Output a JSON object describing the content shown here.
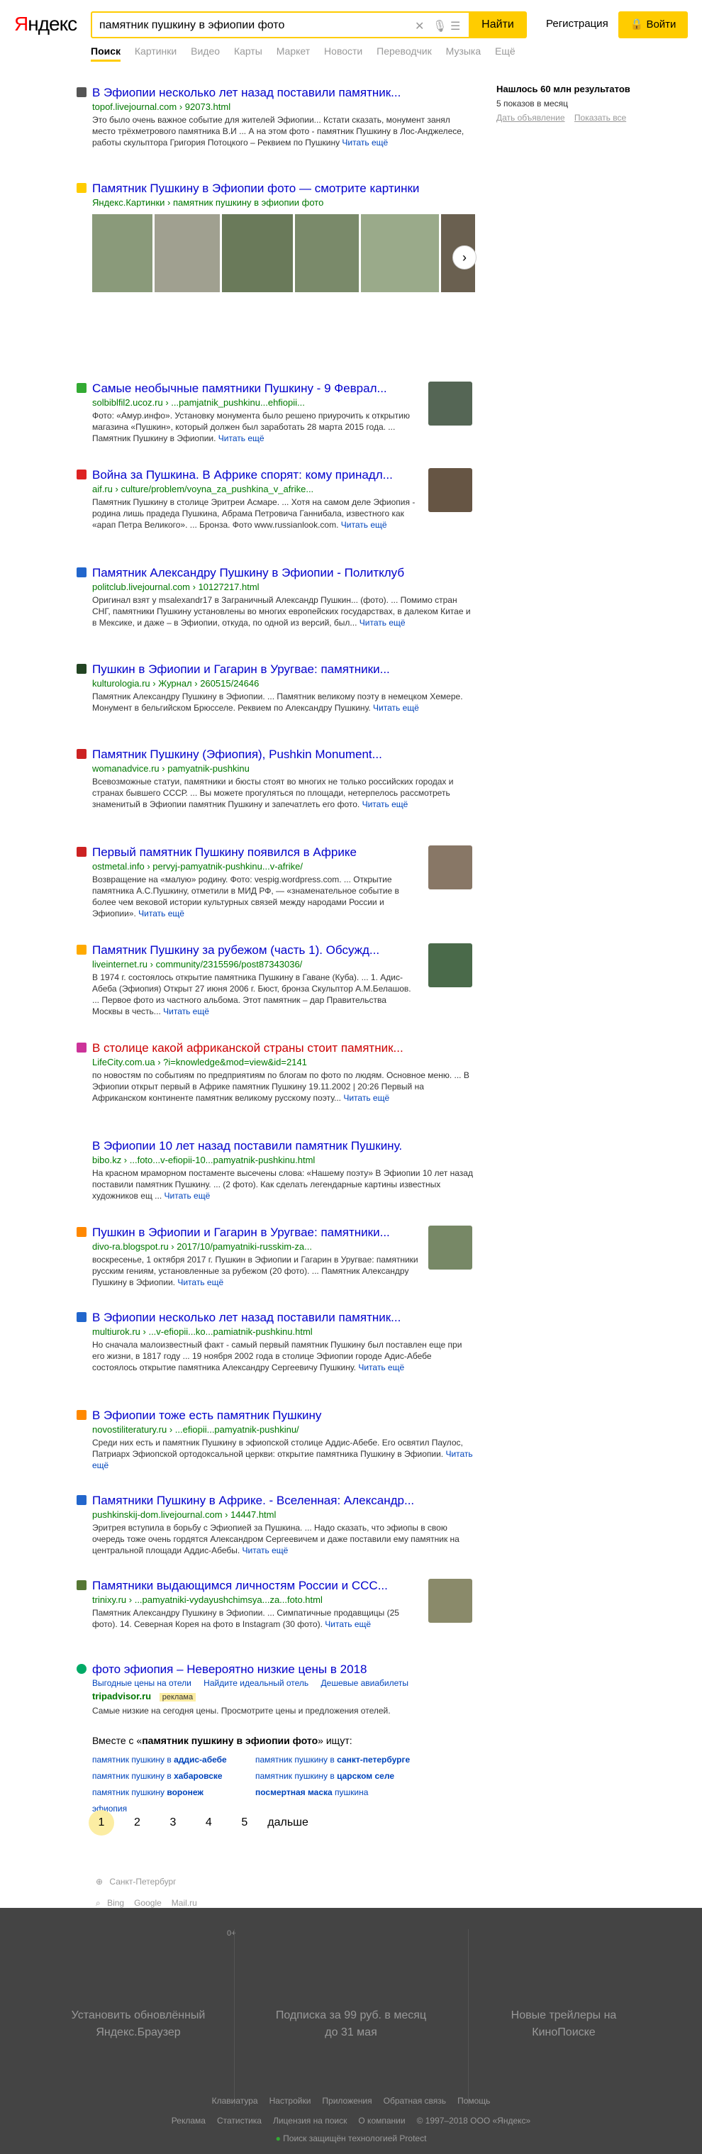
{
  "header": {
    "logo_part1": "Я",
    "logo_part2": "ндекс",
    "query": "памятник пушкину в эфиопии фото",
    "search_button": "Найти",
    "register": "Регистрация",
    "login": "Войти"
  },
  "tabs": [
    "Поиск",
    "Картинки",
    "Видео",
    "Карты",
    "Маркет",
    "Новости",
    "Переводчик",
    "Музыка",
    "Ещё"
  ],
  "sidebar": {
    "found": "Нашлось 60 млн результатов",
    "shows": "5 показов в месяц",
    "ad_link": "Дать объявление",
    "show_all": "Показать все"
  },
  "results": [
    {
      "title": "В Эфиопии несколько лет назад поставили памятник...",
      "url": "topof.livejournal.com › 92073.html",
      "snippet": "Это было очень важное событие для жителей Эфиопии... Кстати сказать, монумент занял место трёхметрового памятника В.И ... А на этом фото - памятник Пушкину в Лос-Анджелесе, работы скульптора Григория Потоцкого – Реквием по Пушкину",
      "more": "Читать ещё",
      "color": "#555555"
    },
    {
      "title": "Памятник Пушкину в Эфиопии фото — смотрите картинки",
      "url": "Яндекс.Картинки › памятник пушкину в эфиопии фото",
      "color": "#ffcc00"
    },
    {
      "title": "Самые необычные памятники Пушкину - 9 Феврал...",
      "url": "solbiblfil2.ucoz.ru › ...pamjatnik_pushkinu...ehfiopii...",
      "snippet": "Фото: «Амур.инфо». Установку монумента было решено приурочить к открытию магазина «Пушкин», который должен был заработать 28 марта 2015 года. ... Памятник Пушкину в Эфиопии.",
      "more": "Читать ещё",
      "color": "#33aa33"
    },
    {
      "title": "Война за Пушкина. В Африке спорят: кому принадл...",
      "url": "aif.ru › culture/problem/voyna_za_pushkina_v_afrike...",
      "snippet": "Памятник Пушкину в столице Эритреи Асмаре. ... Хотя на самом деле Эфиопия - родина лишь прадеда Пушкина, Абрама Петровича Ганнибала, известного как «арап Петра Великого». ... Бронза. Фото www.russianlook.com.",
      "more": "Читать ещё",
      "color": "#dd2222"
    },
    {
      "title": "Памятник Александру Пушкину в Эфиопии - Политклуб",
      "url": "politclub.livejournal.com › 10127217.html",
      "snippet": "Оригинал взят у msalexandr17 в Заграничный Александр Пушкин... (фото). ... Помимо стран СНГ, памятники Пушкину установлены во многих европейских государствах, в далеком Китае и в Мексике, и даже – в Эфиопии, откуда, по одной из версий, был...",
      "more": "Читать ещё",
      "color": "#2266cc"
    },
    {
      "title": "Пушкин в Эфиопии и Гагарин в Уругвае: памятники...",
      "url": "kulturologia.ru › Журнал › 260515/24646",
      "snippet": "Памятник Александру Пушкину в Эфиопии. ... Памятник великому поэту в немецком Хемере. Монумент в бельгийском Брюсселе. Реквием по Александру Пушкину.",
      "more": "Читать ещё",
      "color": "#224422"
    },
    {
      "title": "Памятник Пушкину (Эфиопия), Pushkin Monument...",
      "url": "womanadvice.ru › pamyatnik-pushkinu",
      "snippet": "Всевозможные статуи, памятники и бюсты стоят во многих не только российских городах и странах бывшего СССР. ... Вы можете прогуляться по площади, нетерпелось рассмотреть знаменитый в Эфиопии памятник Пушкину и запечатлеть его фото.",
      "more": "Читать ещё",
      "color": "#cc2222"
    },
    {
      "title": "Первый памятник Пушкину появился в Африке",
      "url": "ostmetal.info › pervyj-pamyatnik-pushkinu...v-afrike/",
      "snippet": "Возвращение на «малую» родину. Фото: vespig.wordpress.com. ... Открытие памятника А.С.Пушкину, отметили в МИД РФ, — «знаменательное событие в более чем вековой истории культурных связей между народами России и Эфиопии».",
      "more": "Читать ещё",
      "color": "#cc2222"
    },
    {
      "title": "Памятник Пушкину за рубежом (часть 1). Обсужд...",
      "url": "liveinternet.ru › community/2315596/post87343036/",
      "snippet": "В 1974 г. состоялось открытие памятника Пушкину в Гаване (Куба). ... 1. Адис-Абеба (Эфиопия) Открыт 27 июня 2006 г. Бюст, бронза Скульптор А.М.Белашов. ... Первое фото из частного альбома. Этот памятник – дар Правительства Москвы в честь...",
      "more": "Читать ещё",
      "color": "#ffaa00"
    },
    {
      "title": "В столице какой африканской страны стоит памятник...",
      "url": "LifeCity.com.ua › ?i=knowledge&mod=view&id=2141",
      "snippet": "по новостям по событиям по предприятиям по блогам по фото по людям. Основное меню. ... В Эфиопии открыт первый в Африке памятник Пушкину 19.11.2002 | 20:26 Первый на Африканском континенте памятник великому русскому поэту...",
      "more": "Читать ещё",
      "color": "#cc3399"
    },
    {
      "title": "В Эфиопии 10 лет назад поставили памятник Пушкину.",
      "url": "bibo.kz › ...foto...v-efiopii-10...pamyatnik-pushkinu.html",
      "snippet": "На красном мраморном постаменте высечены слова: «Нашему поэту» В Эфиопии 10 лет назад поставили памятник Пушкину. ... (2 фото). Как сделать легендарные картины известных художников ещ ...",
      "more": "Читать ещё",
      "color": "#ffffff"
    },
    {
      "title": "Пушкин в Эфиопии и Гагарин в Уругвае: памятники...",
      "url": "divo-ra.blogspot.ru › 2017/10/pamyatniki-russkim-za...",
      "snippet": "воскресенье, 1 октября 2017 г. Пушкин в Эфиопии и Гагарин в Уругвае: памятники русским гениям, установленные за рубежом (20 фото). ... Памятник Александру Пушкину в Эфиопии.",
      "more": "Читать ещё",
      "color": "#ff8800"
    },
    {
      "title": "В Эфиопии несколько лет назад поставили памятник...",
      "url": "multiurok.ru › ...v-efiopii...ko...pamiatnik-pushkinu.html",
      "snippet": "Но сначала малоизвестный факт - самый первый памятник Пушкину был поставлен еще при его жизни, в 1817 году ... 19 ноября 2002 года в столице Эфиопии городе Адис-Абебе состоялось открытие памятника Александру Сергеевичу Пушкину.",
      "more": "Читать ещё",
      "color": "#2266cc"
    },
    {
      "title": "В Эфиопии тоже есть памятник Пушкину",
      "url": "novostiliteratury.ru › ...efiopii...pamyatnik-pushkinu/",
      "snippet": "Среди них есть и памятник Пушкину в эфиопской столице Аддис-Абебе. Его освятил Паулос, Патриарх Эфиопской ортодоксальной церкви: открытие памятника Пушкину в Эфиопии.",
      "more": "Читать ещё",
      "color": "#ff8800"
    },
    {
      "title": "Памятники Пушкину в Африке. - Вселенная: Александр...",
      "url": "pushkinskij-dom.livejournal.com › 14447.html",
      "snippet": "Эритрея вступила в борьбу с Эфиопией за Пушкина. ... Надо сказать, что эфиопы в свою очередь тоже очень гордятся Александром Сергеевичем и даже поставили ему памятник на центральной площади Аддис-Абебы.",
      "more": "Читать ещё",
      "color": "#2266cc"
    },
    {
      "title": "Памятники выдающимся личностям России и ССС...",
      "url": "triniхy.ru › ...pamyatniki-vydayushchimsya...za...foto.html",
      "snippet": "Памятник Александру Пушкину в Эфиопии. ... Симпатичные продавщицы (25 фото). 14. Северная Корея на фото в Instagram (30 фото).",
      "more": "Читать ещё",
      "color": "#557733"
    },
    {
      "title": "фото эфиопия – Невероятно низкие цены в 2018",
      "sitelinks": [
        "Выгодные цены на отели",
        "Найдите идеальный отель",
        "Дешевые авиабилеты"
      ],
      "url": "tripadvisor.ru",
      "ad_label": "реклама",
      "snippet": "Самые низкие на сегодня цены. Просмотрите цены и предложения отелей.",
      "color": "#00aa66"
    }
  ],
  "related": {
    "title_prefix": "Вместе с «",
    "title_query": "памятник пушкину в эфиопии фото",
    "title_suffix": "» ищут:",
    "col1": [
      [
        "памятник пушкину в ",
        "аддис-абебе"
      ],
      [
        "памятник пушкину в ",
        "хабаровске"
      ],
      [
        "памятник пушкину ",
        "воронеж"
      ],
      [
        "эфиопия",
        ""
      ]
    ],
    "col2": [
      [
        "памятник пушкину в ",
        "санкт-петербурге"
      ],
      [
        "памятник пушкину в ",
        "царском селе"
      ],
      [
        "посмертная маска",
        " пушкина"
      ]
    ]
  },
  "pager": {
    "pages": [
      "1",
      "2",
      "3",
      "4",
      "5"
    ],
    "next": "дальше"
  },
  "region": "Санкт-Петербург",
  "other_engines": [
    "Bing",
    "Google",
    "Mail.ru"
  ],
  "footer": {
    "age": "0+",
    "promo1": "Установить обновлённый Яндекс.Браузер",
    "promo2": "Подписка за 99 руб. в месяц до 31 мая",
    "promo3": "Новые трейлеры на КиноПоиске",
    "links1": [
      "Клавиатура",
      "Настройки",
      "Приложения",
      "Обратная связь",
      "Помощь"
    ],
    "links2": [
      "Реклама",
      "Статистика",
      "Лицензия на поиск",
      "О компании",
      "© 1997–2018 ООО «Яндекс»"
    ],
    "protect": "Поиск защищён технологией Protect"
  }
}
